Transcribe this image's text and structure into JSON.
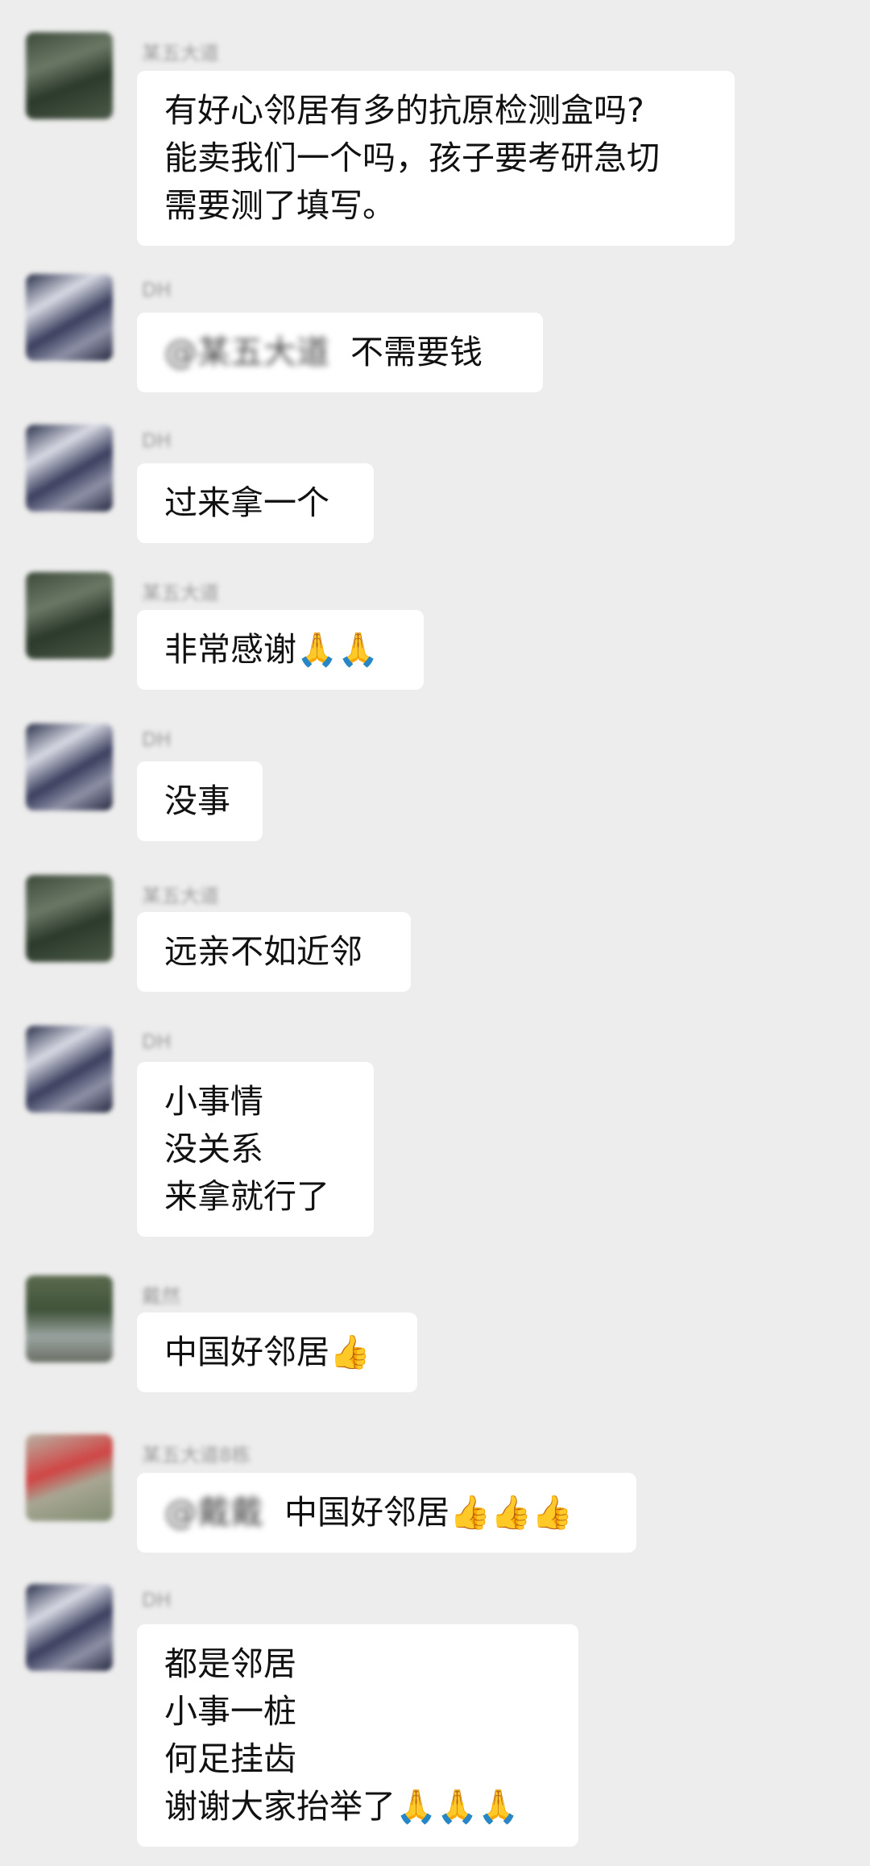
{
  "messages": [
    {
      "sender": "某五大道",
      "lines": [
        "有好心邻居有多的抗原检测盒吗?",
        "能卖我们一个吗，孩子要考研急切",
        "需要测了填写。"
      ]
    },
    {
      "sender": "DH",
      "mention": "@某五大道",
      "lines": [
        "不需要钱"
      ]
    },
    {
      "sender": "DH",
      "lines": [
        "过来拿一个"
      ]
    },
    {
      "sender": "某五大道",
      "lines": [
        "非常感谢🙏🙏"
      ]
    },
    {
      "sender": "DH",
      "lines": [
        "没事"
      ]
    },
    {
      "sender": "某五大道",
      "lines": [
        "远亲不如近邻"
      ]
    },
    {
      "sender": "DH",
      "lines": [
        "小事情",
        "没关系",
        "来拿就行了"
      ]
    },
    {
      "sender": "戴然",
      "lines": [
        "中国好邻居👍"
      ]
    },
    {
      "sender": "某五大道8栋",
      "mention": "@戴戴",
      "lines": [
        "中国好邻居👍👍👍"
      ]
    },
    {
      "sender": "DH",
      "lines": [
        "都是邻居",
        "小事一桩",
        "何足挂齿",
        "谢谢大家抬举了🙏🙏🙏"
      ]
    }
  ]
}
